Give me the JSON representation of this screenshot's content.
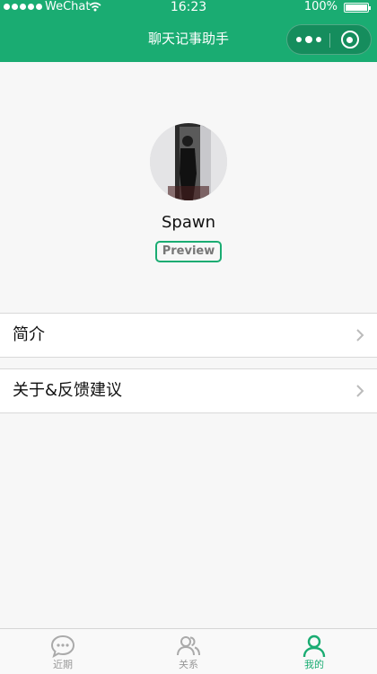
{
  "status_bar": {
    "carrier": "WeChat",
    "time": "16:23",
    "battery": "100%"
  },
  "nav": {
    "title": "聊天记事助手"
  },
  "profile": {
    "username": "Spawn",
    "badge": "Preview"
  },
  "menu": [
    {
      "label": "简介"
    },
    {
      "label": "关于&反馈建议"
    }
  ],
  "tabbar": {
    "items": [
      {
        "label": "近期",
        "icon": "chat-bubble-icon",
        "active": false
      },
      {
        "label": "关系",
        "icon": "users-icon",
        "active": false
      },
      {
        "label": "我的",
        "icon": "person-icon",
        "active": true
      }
    ]
  },
  "colors": {
    "brand": "#1aac72",
    "background": "#f7f7f7",
    "inactive": "#999999"
  }
}
